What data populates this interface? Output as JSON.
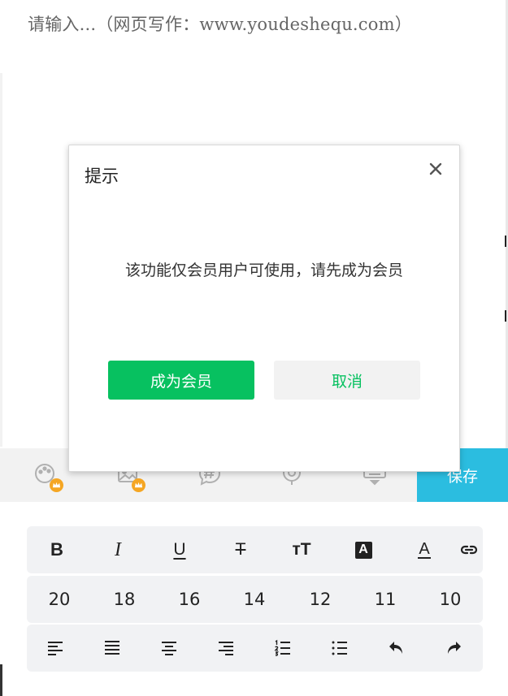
{
  "editor": {
    "placeholder": "请输入...（网页写作：www.youdeshequ.com）"
  },
  "toolbar": {
    "tools": [
      {
        "icon": "palette-icon",
        "premium": true
      },
      {
        "icon": "image-icon",
        "premium": true
      },
      {
        "icon": "hashtag-icon",
        "premium": false
      },
      {
        "icon": "location-icon",
        "premium": false
      },
      {
        "icon": "keyboard-icon",
        "premium": false
      }
    ],
    "save_label": "保存",
    "accent_color": "#2bbde0",
    "premium_badge_color": "#f5a623"
  },
  "format_panel": {
    "style_buttons": [
      "bold-icon",
      "italic-icon",
      "underline-icon",
      "strikethrough-icon",
      "font-size-icon",
      "background-color-icon",
      "font-color-icon",
      "link-icon"
    ],
    "style_labels": {
      "bold": "B",
      "italic": "I",
      "underline": "U",
      "strikethrough": "T",
      "font_size": "тT",
      "background_color": "A",
      "font_color": "A"
    },
    "font_sizes": [
      "20",
      "18",
      "16",
      "14",
      "12",
      "11",
      "10"
    ],
    "paragraph_buttons": [
      "align-left-icon",
      "align-justify-icon",
      "align-center-icon",
      "align-right-icon",
      "ordered-list-icon",
      "unordered-list-icon",
      "undo-icon",
      "redo-icon"
    ]
  },
  "dialog": {
    "title": "提示",
    "message": "该功能仅会员用户可使用，请先成为会员",
    "confirm_label": "成为会员",
    "cancel_label": "取消",
    "primary_color": "#07c160"
  }
}
